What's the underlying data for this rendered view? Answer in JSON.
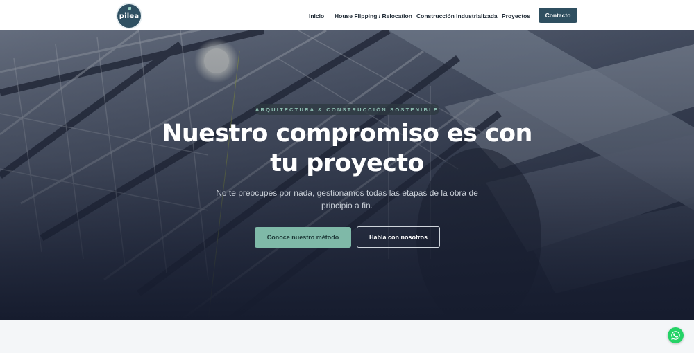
{
  "header": {
    "logo_text": "pilea",
    "nav": [
      {
        "label": "Inicio"
      },
      {
        "label": "House Flipping / Relocation"
      },
      {
        "label": "Construcción Industrializada"
      },
      {
        "label": "Proyectos"
      }
    ],
    "cta_label": "Contacto"
  },
  "hero": {
    "badge": "ARQUITECTURA & CONSTRUCCIÓN SOSTENIBLE",
    "title_line1": "Nuestro compromiso es con",
    "title_line2": "tu proyecto",
    "subtitle_line1": "No te preocupes por nada, gestionamos todas las etapas de la obra de",
    "subtitle_line2": "principio a fin.",
    "primary_button": "Conoce nuestro método",
    "secondary_button": "Habla con nosotros"
  },
  "floating": {
    "icon": "whatsapp-icon"
  },
  "colors": {
    "brand": "#2f4f60",
    "accent": "#7fb9a8",
    "whatsapp": "#25d366"
  }
}
